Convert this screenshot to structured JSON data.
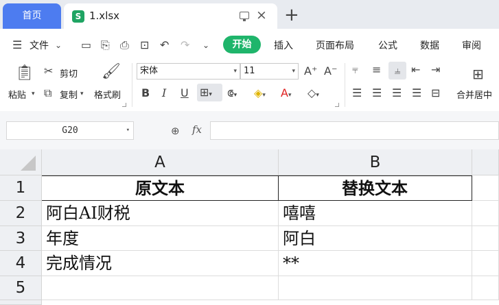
{
  "tabs": {
    "home": "首页",
    "file": "1.xlsx",
    "file_icon": "S"
  },
  "menu": {
    "file": "文件",
    "items": [
      "开始",
      "插入",
      "页面布局",
      "公式",
      "数据",
      "审阅"
    ]
  },
  "ribbon": {
    "paste": "粘贴",
    "cut": "剪切",
    "copy": "复制",
    "format_painter": "格式刷",
    "font_name": "宋体",
    "font_size": "11",
    "merge_center": "合并居中"
  },
  "formula_bar": {
    "cell_ref": "G20",
    "fx": "fx",
    "value": ""
  },
  "sheet": {
    "columns": [
      "A",
      "B"
    ],
    "rows": [
      {
        "num": "1",
        "a": "原文本",
        "b": "替换文本"
      },
      {
        "num": "2",
        "a": "阿白AI财税",
        "b": "嘻嘻"
      },
      {
        "num": "3",
        "a": "年度",
        "b": "阿白"
      },
      {
        "num": "4",
        "a": "完成情况",
        "b": "**"
      },
      {
        "num": "5",
        "a": "",
        "b": ""
      }
    ]
  },
  "colors": {
    "home_tab": "#4d7cf0",
    "start_btn": "#1fb56b",
    "excel_icon": "#1fa463"
  }
}
